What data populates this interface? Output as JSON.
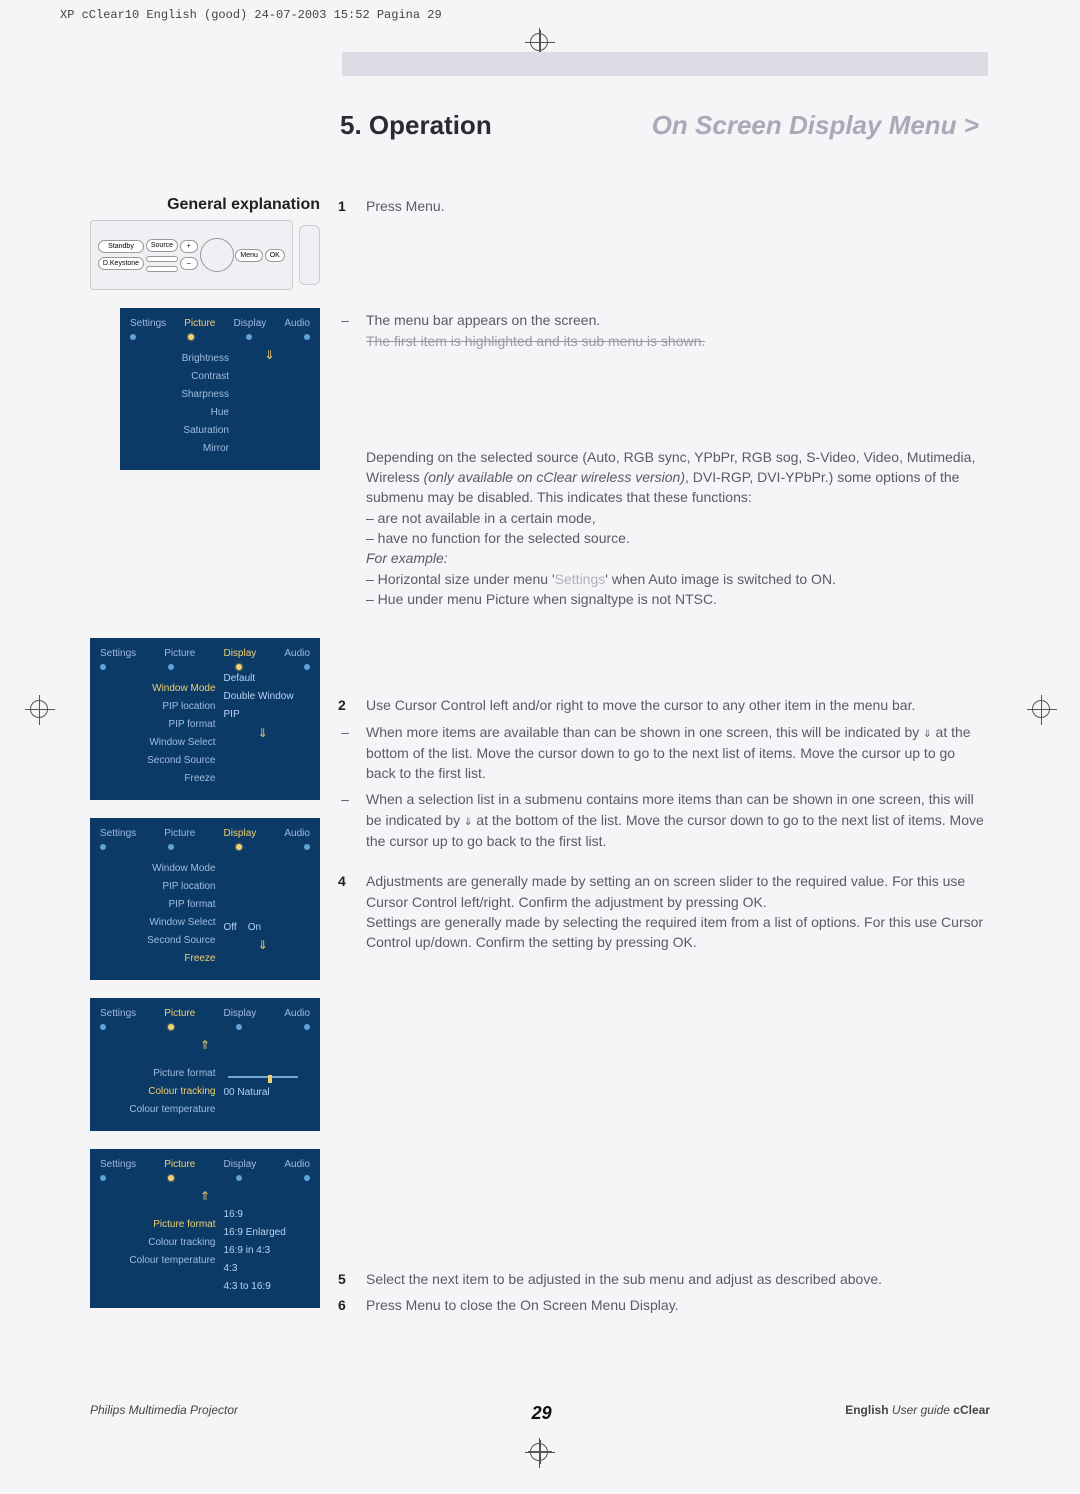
{
  "header_meta": "XP cClear10 English (good) 24-07-2003 15:52 Pagina 29",
  "section": {
    "number": "5. Operation",
    "title": "On Screen Display Menu >"
  },
  "left_heading": "General explanation",
  "panel_buttons": {
    "stby": "Standby",
    "source": "Source",
    "plus": "+",
    "menu": "Menu",
    "ok": "OK",
    "dkey": "D.Keystone",
    "minus": "–"
  },
  "osd1": {
    "tabs": [
      "Settings",
      "Picture",
      "Display",
      "Audio"
    ],
    "active_tab": 1,
    "items": [
      "Brightness",
      "Contrast",
      "Sharpness",
      "Hue",
      "Saturation",
      "Mirror"
    ]
  },
  "osd2": {
    "tabs": [
      "Settings",
      "Picture",
      "Display",
      "Audio"
    ],
    "active_tab": 2,
    "items": [
      "Window Mode",
      "PIP location",
      "PIP format",
      "Window Select",
      "Second Source",
      "Freeze"
    ],
    "highlight_item": "Window Mode",
    "sub": [
      "Default",
      "Double Window",
      "PIP"
    ]
  },
  "osd3": {
    "tabs": [
      "Settings",
      "Picture",
      "Display",
      "Audio"
    ],
    "active_tab": 2,
    "items": [
      "Window Mode",
      "PIP location",
      "PIP format",
      "Window Select",
      "Second Source",
      "Freeze"
    ],
    "highlight_item": "Freeze",
    "sub": [
      "Off",
      "On"
    ]
  },
  "osd4": {
    "tabs": [
      "Settings",
      "Picture",
      "Display",
      "Audio"
    ],
    "active_tab": 1,
    "items": [
      "Picture format",
      "Colour tracking",
      "Colour temperature"
    ],
    "highlight_item": "Colour tracking",
    "slider_label": "00 Natural"
  },
  "osd5": {
    "tabs": [
      "Settings",
      "Picture",
      "Display",
      "Audio"
    ],
    "active_tab": 1,
    "items": [
      "Picture format",
      "Colour tracking",
      "Colour temperature"
    ],
    "highlight_item": "Picture format",
    "sub": [
      "16:9",
      "16:9 Enlarged",
      "16:9 in 4:3",
      "4:3",
      "4:3 to 16:9"
    ]
  },
  "step1": {
    "n": "1",
    "t": "Press Menu."
  },
  "dash": "–",
  "menubar_line1": "The menu bar appears on the screen.",
  "menubar_line2": "The first item is highlighted and its sub menu is shown.",
  "depend_block": {
    "l1": "Depending on the selected source (Auto, RGB sync, YPbPr, RGB sog, S-Video, Video, Mutimedia, Wireless ",
    "l1i": "(only available on cClear wireless version)",
    "l1b": ", DVI-RGP, DVI-YPbPr.) some options of the submenu may be disabled. This indicates that these functions:",
    "b1": " – are not available in a certain mode,",
    "b2": " – have no function for the selected source.",
    "ex": "For example:",
    "e1a": "– Horizontal size under menu '",
    "e1b": "Settings",
    "e1c": "' when Auto image is switched to ON.",
    "e2": "– Hue under menu Picture when signaltype is not NTSC."
  },
  "step2": {
    "n": "2",
    "t": "Use Cursor Control left and/or right to move the cursor to any other item in the menu bar."
  },
  "step2_dashes": [
    {
      "pre": "When more items are available than can be shown in one screen, this will be indicated by ",
      "sym": "⇓",
      "post": " at the bottom of the list. Move the cursor down to go to the next list of items. Move the cursor up to go back to the first list."
    },
    {
      "pre": "When a selection list in a submenu contains more items than can be shown in one screen, this will be indicated by ",
      "sym": "⇓",
      "post": " at the bottom of the list. Move the cursor down to go to the next list of items. Move the cursor up to go back to the first list."
    }
  ],
  "step4": {
    "n": "4",
    "t": "Adjustments are generally made by setting an on screen slider to the required value. For this use Cursor Control left/right. Confirm the adjustment by pressing OK.",
    "t2": "Settings are generally made by selecting the required item from a list of options. For this use Cursor Control up/down. Confirm the setting by pressing OK."
  },
  "step5": {
    "n": "5",
    "t": "Select the next item to be adjusted in the sub menu and adjust as described above."
  },
  "step6": {
    "n": "6",
    "t": "Press Menu to close the On Screen Menu Display."
  },
  "footer": {
    "left": "Philips Multimedia Projector",
    "center": "29",
    "right_lang": "English",
    "right_guide": "User guide",
    "right_prod": "cClear"
  }
}
